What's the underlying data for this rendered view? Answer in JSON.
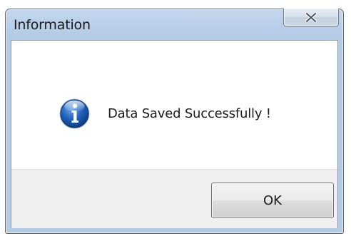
{
  "dialog": {
    "title": "Information",
    "close_icon": "close-icon",
    "message_icon": "info-icon",
    "message": "Data Saved Successfully !",
    "ok_label": "OK"
  },
  "colors": {
    "title_bar": "#b4cbe6",
    "info_icon_blue": "#1d5fb8",
    "button_area": "#f0f0f0"
  }
}
